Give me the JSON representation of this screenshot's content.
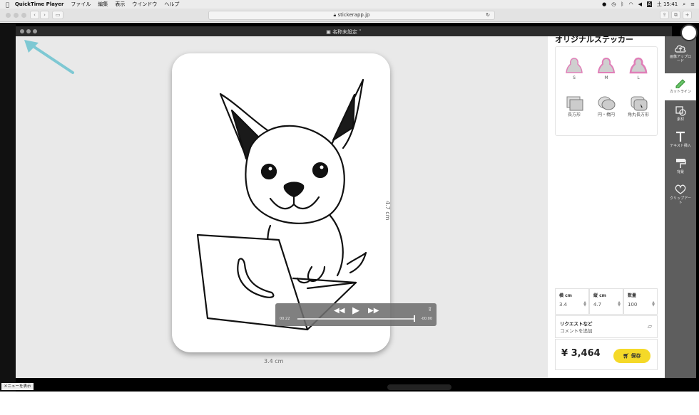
{
  "menubar": {
    "apple": "",
    "app_name": "QuickTime Player",
    "items": [
      "ファイル",
      "編集",
      "表示",
      "ウインドウ",
      "ヘルプ"
    ],
    "status_icons": [
      "user-icon",
      "history-icon",
      "bluetooth-icon",
      "wifi-icon",
      "volume-icon",
      "input-icon"
    ],
    "datetime": "土 15:41"
  },
  "browser": {
    "url": "stickerapp.jp"
  },
  "player": {
    "document_title": "名称未設定 ˅",
    "elapsed": "00:22",
    "remaining": "-00:00",
    "progress": 1.0
  },
  "editor": {
    "panel_title": "オリジナルステッカー",
    "size_options": [
      {
        "label": "S"
      },
      {
        "label": "M"
      },
      {
        "label": "L"
      }
    ],
    "shape_options": [
      {
        "label": "長方形"
      },
      {
        "label": "円・楕円"
      },
      {
        "label": "角丸長方形"
      }
    ],
    "width_label": "横 cm",
    "width_value": "3.4",
    "height_label": "縦 cm",
    "height_value": "4.7",
    "quantity_label": "数量",
    "quantity_value": "100",
    "request_title": "リクエストなど",
    "request_placeholder": "コメントを追加",
    "price": "¥ 3,464",
    "save_label": "保存",
    "dim_width": "3.4 cm",
    "dim_height": "4.7 cm"
  },
  "tools": [
    {
      "label": "画像アップロード"
    },
    {
      "label": "カットライン"
    },
    {
      "label": "素材"
    },
    {
      "label": "テキスト挿入"
    },
    {
      "label": "背景"
    },
    {
      "label": "クリップアート"
    }
  ],
  "bottom_hint": "メニューを表示",
  "colors": {
    "save_button": "#f5d928",
    "arrow": "#7ec8d3",
    "tool_bar": "#5e5e5e"
  }
}
